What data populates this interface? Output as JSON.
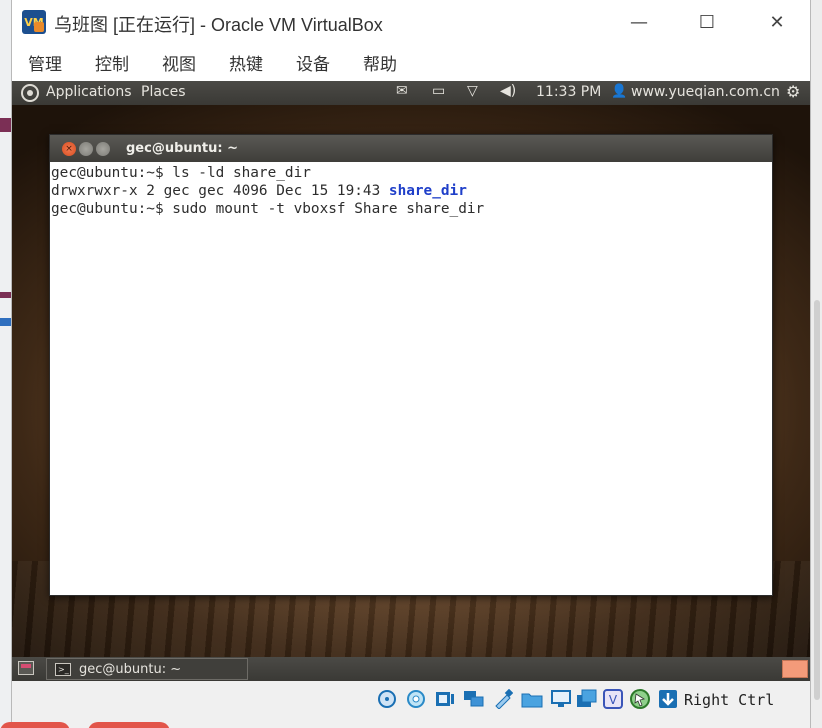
{
  "window": {
    "title": "乌班图 [正在运行] - Oracle VM VirtualBox",
    "minimize": "—",
    "maximize": "☐",
    "close": "✕"
  },
  "menu": [
    "管理",
    "控制",
    "视图",
    "热键",
    "设备",
    "帮助"
  ],
  "guest_topbar": {
    "applications": "Applications",
    "places": "Places",
    "mail_icon": "✉",
    "battery_icon": "▭",
    "wifi_icon": "▽",
    "volume_icon": "◀)",
    "time": "11:33 PM",
    "user_icon": "👤",
    "user": "www.yueqian.com.cn",
    "settings_icon": "⚙"
  },
  "terminal": {
    "title": "gec@ubuntu: ~",
    "close_glyph": "×",
    "lines": {
      "l1": "gec@ubuntu:~$ ls -ld share_dir",
      "l2_prefix": "drwxrwxr-x 2 gec gec 4096 Dec 15 19:43 ",
      "l2_dir": "share_dir",
      "l3": "gec@ubuntu:~$ sudo mount -t vboxsf Share share_dir"
    }
  },
  "taskbar": {
    "task_label": "gec@ubuntu: ~",
    "task_icon_text": ">_"
  },
  "statusbar": {
    "host_key": "Right Ctrl",
    "icons": [
      "hdd-icon",
      "optical-icon",
      "audio-icon",
      "network-icon",
      "usb-icon",
      "shared-folders-icon",
      "display-icon",
      "recording-icon",
      "vtx-icon",
      "mouse-integration-icon",
      "arrow-down-icon"
    ]
  }
}
